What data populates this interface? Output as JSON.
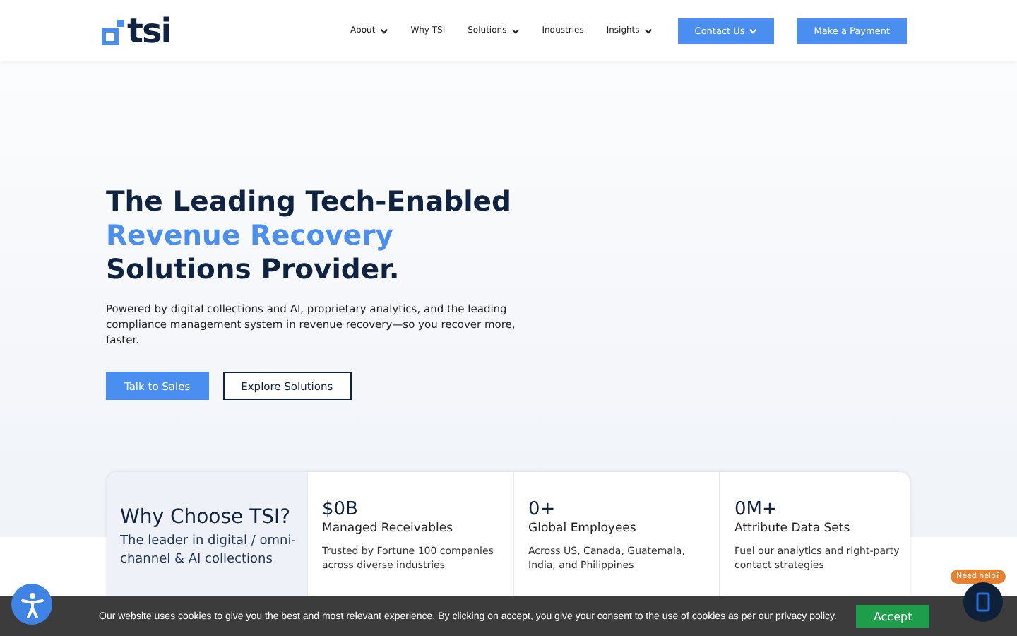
{
  "logo": {
    "text": "tsi"
  },
  "nav": [
    {
      "label": "About",
      "dropdown": true
    },
    {
      "label": "Why TSI",
      "dropdown": false
    },
    {
      "label": "Solutions",
      "dropdown": true
    },
    {
      "label": "Industries",
      "dropdown": false
    },
    {
      "label": "Insights",
      "dropdown": true
    }
  ],
  "header_buttons": [
    {
      "label": "Contact Us",
      "dropdown": true
    },
    {
      "label": "Make a Payment",
      "dropdown": false
    }
  ],
  "hero": {
    "title_lines": [
      {
        "text": "The Leading Tech-Enabled",
        "accent": false
      },
      {
        "text": "Revenue Recovery",
        "accent": true
      },
      {
        "text": "Solutions Provider.",
        "accent": false
      }
    ],
    "text": "Powered by digital collections and AI, proprietary analytics, and the leading compliance management system in revenue recovery—so you recover more, faster.",
    "buttons": [
      {
        "label": "Talk to Sales",
        "kind": "primary"
      },
      {
        "label": "Explore Solutions",
        "kind": "outline"
      }
    ]
  },
  "why": {
    "title": "Why Choose TSI?",
    "subtitle": "The leader in digital / omni-channel & AI collections",
    "stats": [
      {
        "value": "$0B",
        "label": "Managed Receivables",
        "text": "Trusted by Fortune 100 companies across diverse industries"
      },
      {
        "value": "0+",
        "label": "Global Employees",
        "text": "Across US, Canada, Guatemala, India, and Philippines"
      },
      {
        "value": "0M+",
        "label": "Attribute Data Sets",
        "text": "Fuel our analytics and right-party contact strategies"
      }
    ]
  },
  "cookie": {
    "text": "Our website uses cookies to give you the best and most relevant experience. By clicking on accept, you give your consent to the use of cookies as per our privacy policy.",
    "button": "Accept"
  },
  "help": {
    "badge": "Need help?"
  }
}
